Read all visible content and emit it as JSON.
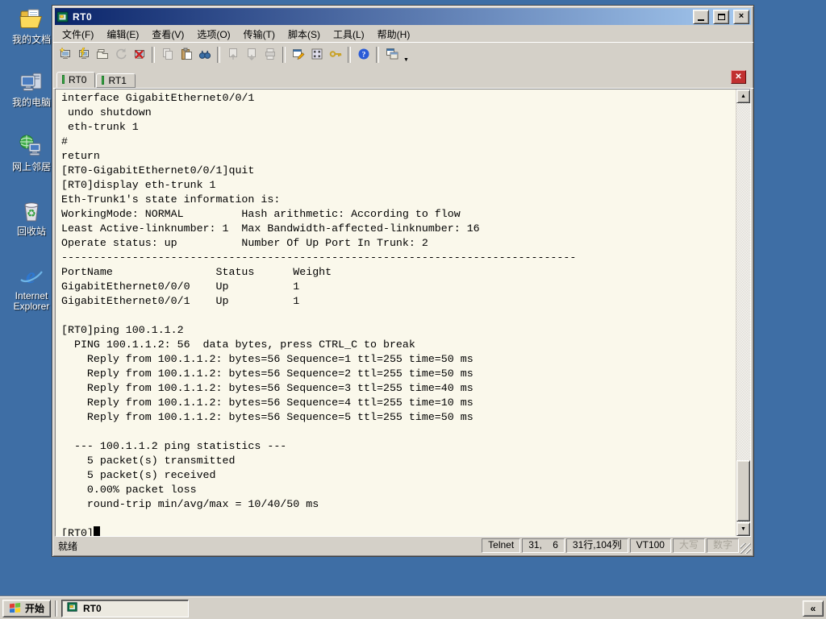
{
  "desktop": {
    "icons": [
      {
        "name": "desktop-icon-my-documents",
        "icon": "my-documents",
        "label": "我的文档"
      },
      {
        "name": "desktop-icon-my-computer",
        "icon": "my-computer",
        "label": "我的电脑"
      },
      {
        "name": "desktop-icon-network-places",
        "icon": "network-places",
        "label": "网上邻居"
      },
      {
        "name": "desktop-icon-recycle-bin",
        "icon": "recycle-bin",
        "label": "回收站"
      },
      {
        "name": "desktop-icon-internet-explorer",
        "icon": "internet-explorer",
        "label": "Internet Explorer"
      }
    ]
  },
  "window": {
    "title": "RT0",
    "menu": {
      "items": [
        {
          "name": "menu-file",
          "label": "文件(F)"
        },
        {
          "name": "menu-edit",
          "label": "编辑(E)"
        },
        {
          "name": "menu-view",
          "label": "查看(V)"
        },
        {
          "name": "menu-options",
          "label": "选项(O)"
        },
        {
          "name": "menu-transfer",
          "label": "传输(T)"
        },
        {
          "name": "menu-script",
          "label": "脚本(S)"
        },
        {
          "name": "menu-tools",
          "label": "工具(L)"
        },
        {
          "name": "menu-help",
          "label": "帮助(H)"
        }
      ]
    },
    "toolbar": {
      "items": [
        {
          "name": "new-session-icon",
          "enabled": true
        },
        {
          "name": "quick-connect-icon",
          "enabled": true
        },
        {
          "name": "tab-connect-icon",
          "enabled": true
        },
        {
          "name": "reconnect-icon",
          "enabled": false
        },
        {
          "name": "disconnect-icon",
          "enabled": true
        },
        {
          "sep": true
        },
        {
          "name": "copy-icon",
          "enabled": false
        },
        {
          "name": "paste-icon",
          "enabled": true
        },
        {
          "name": "find-icon",
          "enabled": true
        },
        {
          "sep": true
        },
        {
          "name": "send-file-icon",
          "enabled": false
        },
        {
          "name": "receive-file-icon",
          "enabled": false
        },
        {
          "name": "print-icon",
          "enabled": false
        },
        {
          "sep": true
        },
        {
          "name": "session-options-icon",
          "enabled": true
        },
        {
          "name": "keymap-icon",
          "enabled": true
        },
        {
          "name": "key-icon",
          "enabled": true
        },
        {
          "sep": true
        },
        {
          "name": "help-icon",
          "enabled": true
        },
        {
          "sep": true
        },
        {
          "name": "cascade-icon",
          "enabled": true
        }
      ]
    },
    "tabs": [
      {
        "name": "tab-rt0",
        "label": "RT0",
        "active": true
      },
      {
        "name": "tab-rt1",
        "label": "RT1",
        "active": false
      }
    ],
    "terminal": {
      "cursor": true,
      "lines": [
        "interface GigabitEthernet0/0/1",
        " undo shutdown",
        " eth-trunk 1",
        "#",
        "return",
        "[RT0-GigabitEthernet0/0/1]quit",
        "[RT0]display eth-trunk 1",
        "Eth-Trunk1's state information is:",
        "WorkingMode: NORMAL         Hash arithmetic: According to flow",
        "Least Active-linknumber: 1  Max Bandwidth-affected-linknumber: 16",
        "Operate status: up          Number Of Up Port In Trunk: 2",
        "--------------------------------------------------------------------------------",
        "PortName                Status      Weight",
        "GigabitEthernet0/0/0    Up          1",
        "GigabitEthernet0/0/1    Up          1",
        "",
        "[RT0]ping 100.1.1.2",
        "  PING 100.1.1.2: 56  data bytes, press CTRL_C to break",
        "    Reply from 100.1.1.2: bytes=56 Sequence=1 ttl=255 time=50 ms",
        "    Reply from 100.1.1.2: bytes=56 Sequence=2 ttl=255 time=50 ms",
        "    Reply from 100.1.1.2: bytes=56 Sequence=3 ttl=255 time=40 ms",
        "    Reply from 100.1.1.2: bytes=56 Sequence=4 ttl=255 time=10 ms",
        "    Reply from 100.1.1.2: bytes=56 Sequence=5 ttl=255 time=50 ms",
        "",
        "  --- 100.1.1.2 ping statistics ---",
        "    5 packet(s) transmitted",
        "    5 packet(s) received",
        "    0.00% packet loss",
        "    round-trip min/avg/max = 10/40/50 ms",
        "",
        "[RT0]"
      ]
    },
    "statusbar": {
      "ready": "就绪",
      "panes": [
        {
          "name": "status-protocol",
          "label": "Telnet"
        },
        {
          "name": "status-cursor-position",
          "label": "31,    6"
        },
        {
          "name": "status-terminal-size",
          "label": "31行,104列"
        },
        {
          "name": "status-emulation",
          "label": "VT100"
        },
        {
          "name": "status-caps-lock",
          "label": "大写",
          "enabled": false
        },
        {
          "name": "status-num-lock",
          "label": "数字",
          "enabled": false
        }
      ]
    }
  },
  "taskbar": {
    "start_label": "开始",
    "tasks": [
      {
        "name": "taskbar-task-rt0",
        "label": "RT0",
        "active": true
      }
    ],
    "tray_toggle": "«"
  },
  "colors": {
    "desktop": "#3E6EA5",
    "titlebar_start": "#0A246A",
    "titlebar_end": "#A6CAF0",
    "chrome": "#D4D0C8",
    "terminal_bg": "#FAF8EB",
    "tab_indicator": "#3FAE49",
    "tab_close": "#C13030"
  }
}
